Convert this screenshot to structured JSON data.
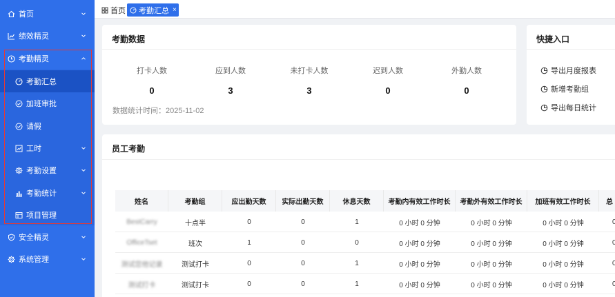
{
  "sidebar": {
    "items": [
      {
        "label": "首页",
        "icon": "home-icon"
      },
      {
        "label": "绩效精灵",
        "icon": "chart-line-icon"
      },
      {
        "label": "考勤精灵",
        "icon": "clock-icon"
      },
      {
        "label": "考勤汇总",
        "icon": "dashboard-icon"
      },
      {
        "label": "加班审批",
        "icon": "check-circle-icon"
      },
      {
        "label": "请假",
        "icon": "check-circle-icon"
      },
      {
        "label": "工时",
        "icon": "bar-chart-icon"
      },
      {
        "label": "考勤设置",
        "icon": "gear-icon"
      },
      {
        "label": "考勤统计",
        "icon": "column-chart-icon"
      },
      {
        "label": "项目管理",
        "icon": "table-icon"
      },
      {
        "label": "安全精灵",
        "icon": "shield-icon"
      },
      {
        "label": "系统管理",
        "icon": "gear-icon"
      }
    ]
  },
  "tabs": {
    "home": "首页",
    "current": "考勤汇总",
    "close": "×"
  },
  "attendance": {
    "title": "考勤数据",
    "stats": [
      {
        "label": "打卡人数",
        "value": "0"
      },
      {
        "label": "应到人数",
        "value": "3"
      },
      {
        "label": "未打卡人数",
        "value": "3"
      },
      {
        "label": "迟到人数",
        "value": "0"
      },
      {
        "label": "外勤人数",
        "value": "0"
      }
    ],
    "stat_time": "数据统计时间：2025-11-02"
  },
  "quick": {
    "title": "快捷入口",
    "items": [
      "导出月度报表",
      "新增考勤组",
      "导出每日统计"
    ]
  },
  "employee": {
    "title": "员工考勤",
    "headers": [
      "姓名",
      "考勤组",
      "应出勤天数",
      "实际出勤天数",
      "休息天数",
      "考勤内有效工作时长",
      "考勤外有效工作时长",
      "加班有效工作时长",
      "总"
    ],
    "rows": [
      [
        "BestCarry",
        "十点半",
        "0",
        "0",
        "1",
        "0 小时 0 分钟",
        "0 小时 0 分钟",
        "0 小时 0 分钟",
        "0"
      ],
      [
        "OfficeTset",
        "班次",
        "1",
        "0",
        "0",
        "0 小时 0 分钟",
        "0 小时 0 分钟",
        "0 小时 0 分钟",
        "0"
      ],
      [
        "测试您他记录",
        "测试打卡",
        "0",
        "0",
        "1",
        "0 小时 0 分钟",
        "0 小时 0 分钟",
        "0 小时 0 分钟",
        "0"
      ],
      [
        "测试打卡",
        "测试打卡",
        "0",
        "0",
        "1",
        "0 小时 0 分钟",
        "0 小时 0 分钟",
        "0 小时 0 分钟",
        "0"
      ]
    ]
  },
  "colors": {
    "sidebar": "#2f6fea",
    "active": "#1b52c4",
    "highlight_box": "#e53935"
  }
}
